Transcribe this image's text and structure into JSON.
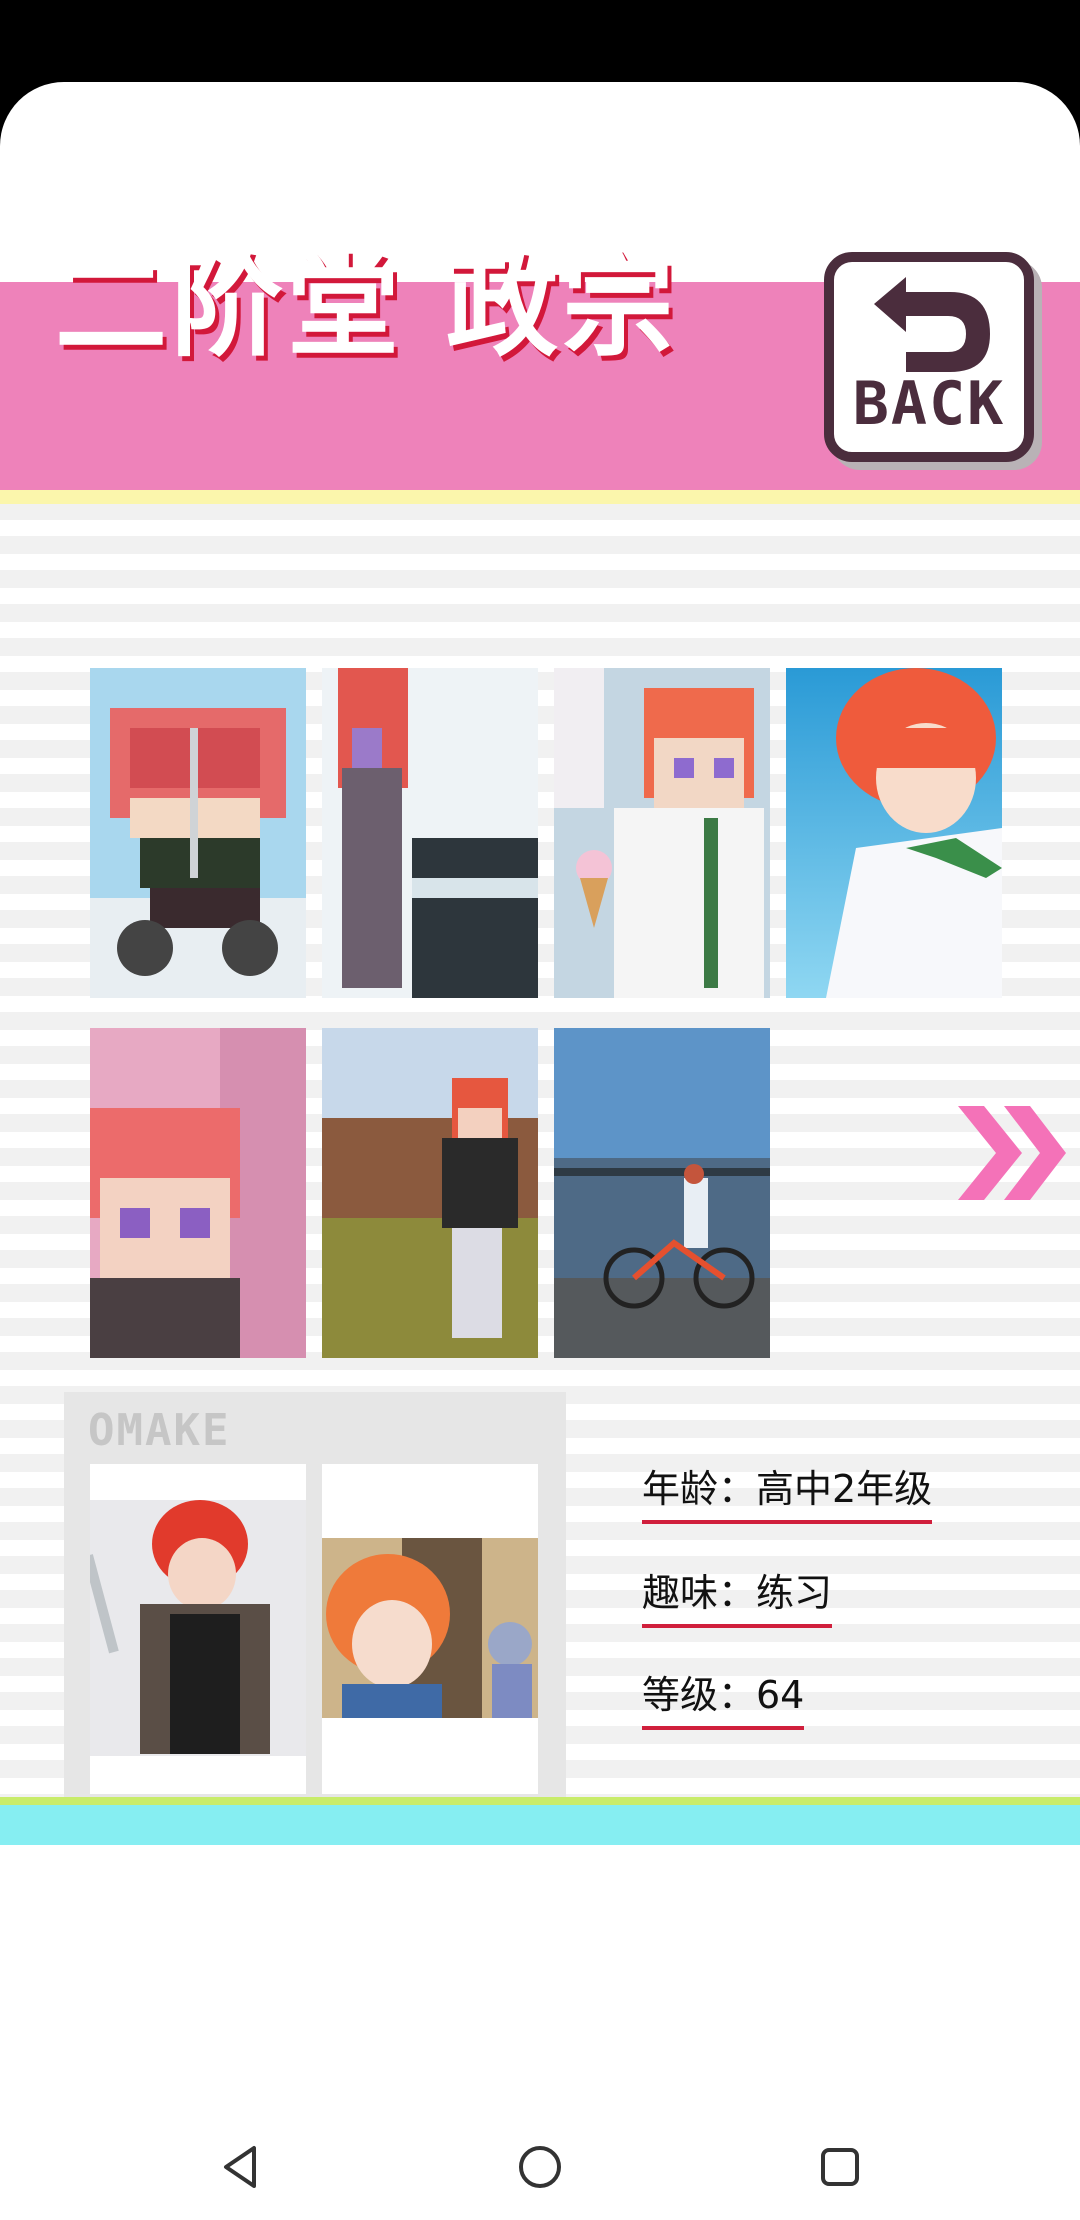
{
  "header": {
    "title": "二阶堂 政宗",
    "back_label": "BACK"
  },
  "gallery": {
    "items": [
      {
        "icon": "segway-pixel-thumbnail"
      },
      {
        "icon": "piano-pixel-thumbnail"
      },
      {
        "icon": "icecream-pixel-thumbnail"
      },
      {
        "icon": "anime-portrait-thumbnail"
      },
      {
        "icon": "cherry-blossom-pixel-thumbnail"
      },
      {
        "icon": "park-pixel-thumbnail"
      },
      {
        "icon": "bicycle-photo-thumbnail"
      }
    ],
    "next_icon": "double-chevron-right-icon"
  },
  "omake": {
    "label": "OMAKE",
    "items": [
      {
        "icon": "cooking-illustration-thumbnail"
      },
      {
        "icon": "childhood-illustration-thumbnail"
      }
    ]
  },
  "profile": {
    "age": "年龄：高中2年级",
    "hobby": "趣味：练习",
    "level": "等级：64"
  },
  "colors": {
    "header_pink": "#ee82ba",
    "header_yellow": "#fbf6ac",
    "title_shadow": "#d2183a",
    "underline_red": "#d01f3c",
    "footer_green": "#c8ec6a",
    "footer_cyan": "#86eef2",
    "arrow_pink": "#f472b8"
  }
}
